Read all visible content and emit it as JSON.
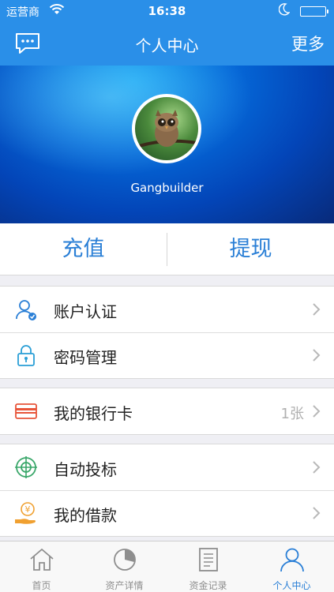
{
  "status_bar": {
    "carrier": "运营商",
    "time": "16:38"
  },
  "nav": {
    "title": "个人中心",
    "more_label": "更多",
    "left_icon": "message-icon"
  },
  "profile": {
    "username": "Gangbuilder",
    "avatar_icon": "owl-avatar"
  },
  "actions": {
    "recharge_label": "充值",
    "withdraw_label": "提现"
  },
  "menu": {
    "account_verify": {
      "label": "账户认证",
      "icon": "user-check-icon"
    },
    "password": {
      "label": "密码管理",
      "icon": "lock-icon"
    },
    "bank_card": {
      "label": "我的银行卡",
      "value": "1张",
      "icon": "bank-card-icon"
    },
    "auto_invest": {
      "label": "自动投标",
      "icon": "target-icon"
    },
    "loans": {
      "label": "我的借款",
      "icon": "yen-hand-icon"
    }
  },
  "tabs": [
    {
      "label": "首页",
      "icon": "home-icon",
      "active": false
    },
    {
      "label": "资产详情",
      "icon": "pie-chart-icon",
      "active": false
    },
    {
      "label": "资金记录",
      "icon": "document-icon",
      "active": false
    },
    {
      "label": "个人中心",
      "icon": "person-icon",
      "active": true
    }
  ],
  "colors": {
    "accent": "#2a8fe8",
    "link_blue": "#2a7fd6",
    "card_red": "#e8553a",
    "target_green": "#3aa76a",
    "coin_orange": "#f0a030"
  }
}
